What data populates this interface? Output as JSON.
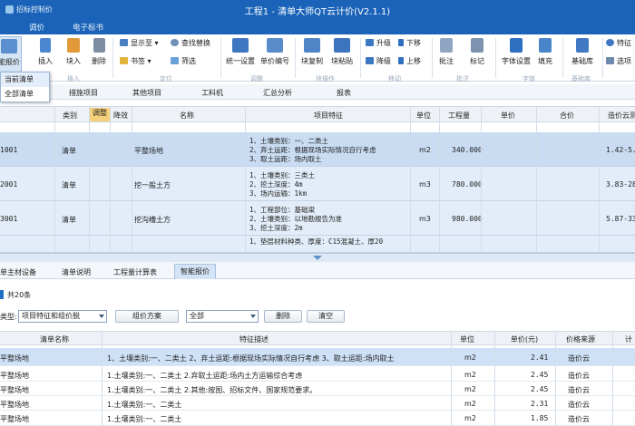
{
  "titlebar": {
    "app_name": "招标控制价",
    "window_title": "工程1 - 清单大师QT云计价(V2.1.1)"
  },
  "menubar": {
    "tabs": [
      "调价",
      "电子标书"
    ]
  },
  "ribbon": {
    "buttons": [
      "能报价",
      "插入",
      "块入",
      "删除",
      "统一设置",
      "单价编号",
      "块复制",
      "块粘贴",
      "批注",
      "标记",
      "字体设置",
      "填充",
      "基础库",
      "特征"
    ],
    "small": [
      "显示至",
      "书签",
      "查找替换",
      "筛选",
      "升级",
      "降级",
      "下移",
      "上移",
      "选项"
    ],
    "groups": [
      "插入",
      "定位",
      "调整",
      "块操作",
      "移动",
      "批注",
      "字体",
      "基础库"
    ]
  },
  "dropdown": {
    "items": [
      "当前清单",
      "全部清单"
    ]
  },
  "tabs1": [
    "措施项目",
    "其他项目",
    "工料机",
    "汇总分析",
    "报表"
  ],
  "table1": {
    "headers": [
      "类别",
      "调整",
      "降效",
      "名称",
      "项目特征",
      "单位",
      "工程量",
      "单价",
      "合价",
      "造价云测"
    ],
    "rows": [
      {
        "code": "1001",
        "type": "清单",
        "name": "平整场地",
        "feat": [
          "1、土壤类别：一、二类土",
          "2、弃土运距：根据现场实际情况自行考虑",
          "3、取土运距：场内取土"
        ],
        "unit": "m2",
        "qty": "340.000",
        "cloud": "1.42-5."
      },
      {
        "code": "2001",
        "type": "清单",
        "name": "挖一般土方",
        "feat": [
          "1、土壤类别：三类土",
          "2、挖土深度：4m",
          "3、场内运输：1km"
        ],
        "unit": "m3",
        "qty": "780.000",
        "cloud": "3.83-28"
      },
      {
        "code": "3001",
        "type": "清单",
        "name": "挖沟槽土方",
        "feat": [
          "1、工程部位：基础梁",
          "2、土壤类别：以地勘报告为准",
          "3、挖土深度：2m"
        ],
        "unit": "m3",
        "qty": "980.000",
        "cloud": "5.87-33"
      },
      {
        "code": "",
        "type": "",
        "name": "",
        "feat": [
          "1、垫层材料种类、厚度：C15混凝土、厚20"
        ],
        "unit": "",
        "qty": "",
        "cloud": ""
      }
    ]
  },
  "tabs2": [
    "单主材设备",
    "清单说明",
    "工程量计算表",
    "智能报价"
  ],
  "countbar": {
    "label": "共20条"
  },
  "filterbar": {
    "type_label": "类型:",
    "type_value": "项目特征和组价脱",
    "price_plan": "组价方案",
    "scope_value": "全部",
    "delete": "删除",
    "clear": "清空"
  },
  "table2": {
    "headers": [
      "清单名称",
      "特征描述",
      "单位",
      "单价(元)",
      "价格来源",
      "计"
    ],
    "rows": [
      {
        "name": "平整场地",
        "desc": "1、土壤类别:一、二类土 2、弃土运距:根据现场实际情况自行考虑 3、取土运距:场内取土",
        "unit": "m2",
        "price": "2.41",
        "src": "造价云"
      },
      {
        "name": "平整场地",
        "desc": "1.土壤类别:一、二类土 2.弃取土运距:场内土方运输综合考虑",
        "unit": "m2",
        "price": "2.45",
        "src": "造价云"
      },
      {
        "name": "平整场地",
        "desc": "1.土壤类别:一、二类土 2.其他:按图、招标文件、国家规范要求。",
        "unit": "m2",
        "price": "2.45",
        "src": "造价云"
      },
      {
        "name": "平整场地",
        "desc": "1.土壤类别:一、二类土",
        "unit": "m2",
        "price": "2.31",
        "src": "造价云"
      },
      {
        "name": "平整场地",
        "desc": "1.土壤类别:一、二类土",
        "unit": "m2",
        "price": "1.85",
        "src": "造价云"
      }
    ]
  },
  "colors": {
    "titlebar": "#1a63b8",
    "selected_row": "#c9dcf2",
    "accent": "#1f6fc5"
  }
}
